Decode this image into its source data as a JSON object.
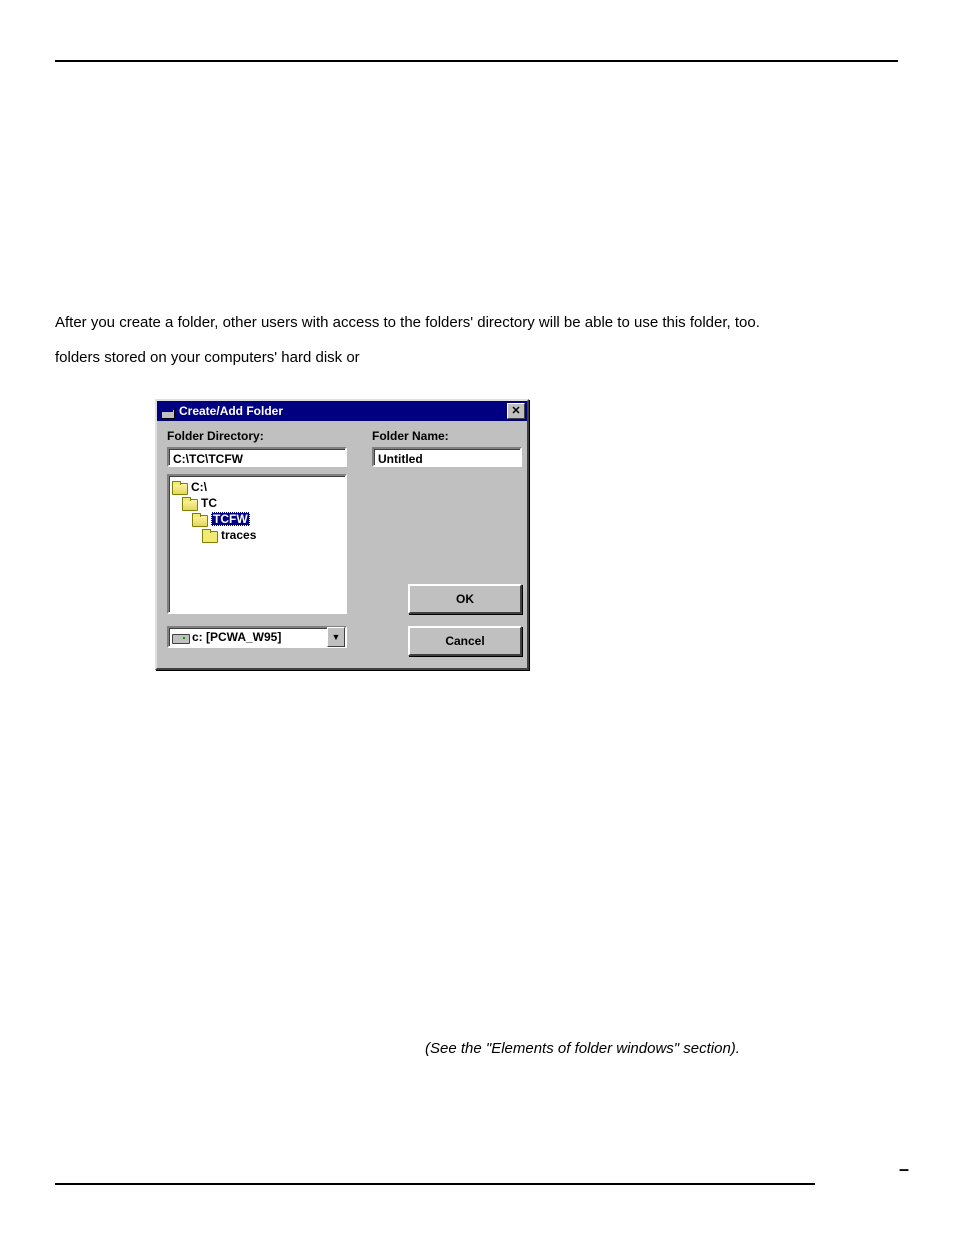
{
  "paragraphs": {
    "p1": "After you create a folder, other users with access to the folders' directory will be able to use this folder, too.",
    "p2": "folders stored on your computers' hard disk or"
  },
  "dialog": {
    "title": "Create/Add Folder",
    "close_glyph": "✕",
    "labels": {
      "folder_directory": "Folder Directory:",
      "folder_name": "Folder Name:"
    },
    "path_value": "C:\\TC\\TCFW",
    "name_value": "Untitled",
    "tree": [
      {
        "label": "C:\\",
        "indent": 0,
        "open": true,
        "selected": false
      },
      {
        "label": "TC",
        "indent": 1,
        "open": true,
        "selected": false
      },
      {
        "label": "TCFW",
        "indent": 2,
        "open": true,
        "selected": true
      },
      {
        "label": "traces",
        "indent": 3,
        "open": false,
        "selected": false
      }
    ],
    "drive_value": "c: [PCWA_W95]",
    "combo_arrow": "▼",
    "buttons": {
      "ok": "OK",
      "cancel": "Cancel"
    }
  },
  "footnote": "(See the \"Elements of folder windows\" section).",
  "page_corner": "–"
}
